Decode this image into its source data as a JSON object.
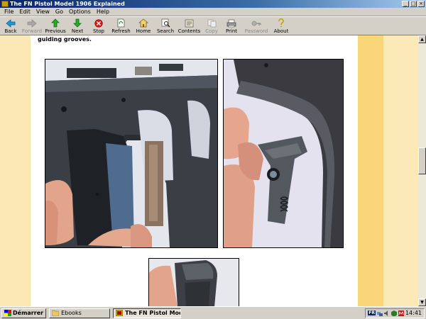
{
  "window": {
    "title": "The FN Pistol Model 1906 Explained",
    "controls": {
      "minimize": "_",
      "maximize": "□",
      "close": "×"
    }
  },
  "menu": [
    "File",
    "Edit",
    "View",
    "Go",
    "Options",
    "Help"
  ],
  "toolbar": {
    "buttons": [
      {
        "label": "Back",
        "icon": "back-arrow-icon",
        "enabled": true
      },
      {
        "label": "Forward",
        "icon": "forward-arrow-icon",
        "enabled": false
      },
      {
        "label": "Previous",
        "icon": "up-arrow-icon",
        "enabled": true
      },
      {
        "label": "Next",
        "icon": "down-arrow-icon",
        "enabled": true
      },
      {
        "label": "Stop",
        "icon": "stop-icon",
        "enabled": true
      },
      {
        "label": "Refresh",
        "icon": "refresh-icon",
        "enabled": true
      },
      {
        "label": "Home",
        "icon": "home-icon",
        "enabled": true
      },
      {
        "label": "Search",
        "icon": "search-icon",
        "enabled": true
      },
      {
        "label": "Contents",
        "icon": "contents-icon",
        "enabled": true
      },
      {
        "label": "Copy",
        "icon": "copy-icon",
        "enabled": false
      },
      {
        "label": "Print",
        "icon": "print-icon",
        "enabled": true
      },
      {
        "label": "Password",
        "icon": "key-icon",
        "enabled": false
      },
      {
        "label": "About",
        "icon": "about-icon",
        "enabled": true
      }
    ]
  },
  "document": {
    "text_fragment": "guiding grooves.",
    "photos": [
      "pistol-frame-photo",
      "sear-and-spring-photo",
      "part-close-up-photo"
    ]
  },
  "taskbar": {
    "start_label": "Démarrer",
    "tasks": [
      {
        "label": "Ebooks",
        "active": false
      },
      {
        "label": "The FN Pistol Model 19...",
        "active": true
      }
    ],
    "tray": {
      "language": "FR",
      "time": "14:41"
    }
  },
  "colors": {
    "title_bar": "#0a246a",
    "chrome": "#d4d0c8",
    "band_light": "#fbe8b5",
    "band_accent": "#fad57a"
  }
}
